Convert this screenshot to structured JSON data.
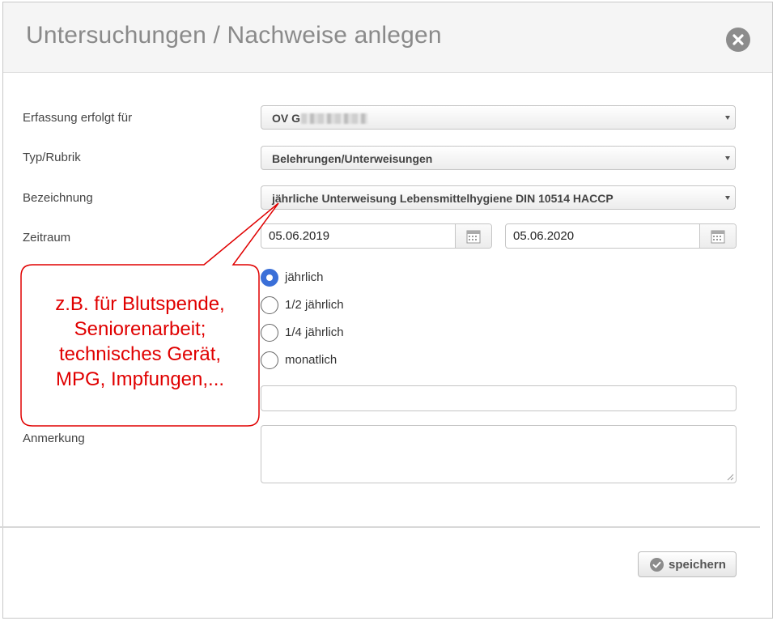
{
  "dialog": {
    "title": "Untersuchungen / Nachweise anlegen",
    "close_icon": "close-circle-icon"
  },
  "form": {
    "erfassung": {
      "label": "Erfassung erfolgt für",
      "value": "OV G"
    },
    "typ": {
      "label": "Typ/Rubrik",
      "value": "Belehrungen/Unterweisungen"
    },
    "bezeichnung": {
      "label": "Bezeichnung",
      "value": "jährliche Unterweisung Lebensmittelhygiene DIN 10514 HACCP"
    },
    "zeitraum": {
      "label": "Zeitraum",
      "from": "05.06.2019",
      "to": "05.06.2020",
      "calendar_icon": "calendar-icon"
    },
    "interval": {
      "selected": "jährlich",
      "options": [
        "jährlich",
        "1/2 jährlich",
        "1/4 jährlich",
        "monatlich"
      ]
    },
    "extra_field": {
      "value": ""
    },
    "anmerkung": {
      "label": "Anmerkung",
      "value": ""
    }
  },
  "footer": {
    "save_label": "speichern",
    "save_icon": "check-circle-icon"
  },
  "annotation": {
    "lines": [
      "z.B. für Blutspende,",
      "Seniorenarbeit;",
      "technisches Gerät,",
      "MPG, Impfungen,..."
    ],
    "color": "#e00000"
  },
  "colors": {
    "radio_selected": "#3a6fd8",
    "title": "#8a8a8a"
  }
}
